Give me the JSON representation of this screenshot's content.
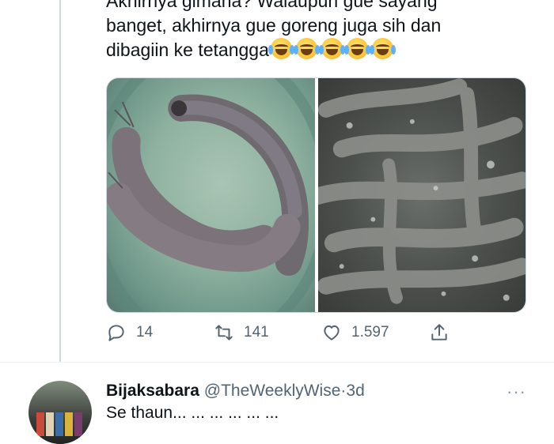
{
  "tweet": {
    "text": "Akhirnya gimana? Walaupun gue sayang\nbanget, akhirnya gue goreng juga sih dan\ndibagiin ke tetangga",
    "emoji": "😂😂😂😂😂",
    "media": [
      {
        "alt": "two catfish in a green basin"
      },
      {
        "alt": "many catfish in water"
      }
    ],
    "actions": {
      "reply_count": "14",
      "retweet_count": "141",
      "like_count": "1.597"
    }
  },
  "reply": {
    "display_name": "Bijaksabara",
    "handle": "@TheWeeklyWise",
    "separator": "·",
    "time": "3d",
    "more": "···",
    "text": "Se thaun... ... ... ... ... ..."
  },
  "colors": {
    "text": "#0f1419",
    "secondary": "#536471",
    "divider": "#eff3f4"
  }
}
